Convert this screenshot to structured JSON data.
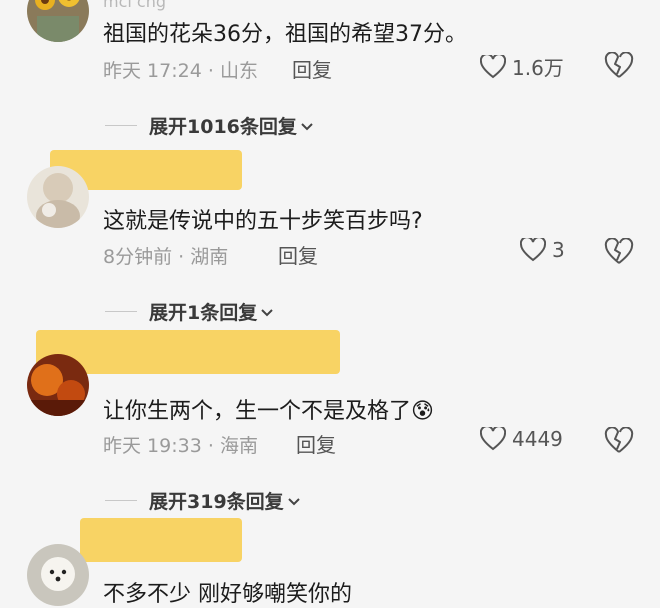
{
  "comments": [
    {
      "name_partial": "ⅿⅽⅼ ⅽng",
      "text": "祖国的花朵36分，祖国的希望37分。",
      "time": "昨天 17:24",
      "location": "山东",
      "reply_label": "回复",
      "likes": "1.6万"
    },
    {
      "text": "这就是传说中的五十步笑百步吗?",
      "time": "8分钟前",
      "location": "湖南",
      "reply_label": "回复",
      "likes": "3"
    },
    {
      "text": "让你生两个，生一个不是及格了",
      "emoji": "😰",
      "time": "昨天 19:33",
      "location": "海南",
      "reply_label": "回复",
      "likes": "4449"
    },
    {
      "text": "不多不少 刚好够嘲笑你的"
    }
  ],
  "expand_replies": [
    "展开1016条回复",
    "展开1条回复",
    "展开319条回复"
  ],
  "icons": {
    "like": "heart-outline-icon",
    "dislike": "broken-heart-icon",
    "expand": "chevron-down-icon"
  },
  "colors": {
    "redaction": "#f8d15c",
    "meta": "#9a9a9a"
  }
}
